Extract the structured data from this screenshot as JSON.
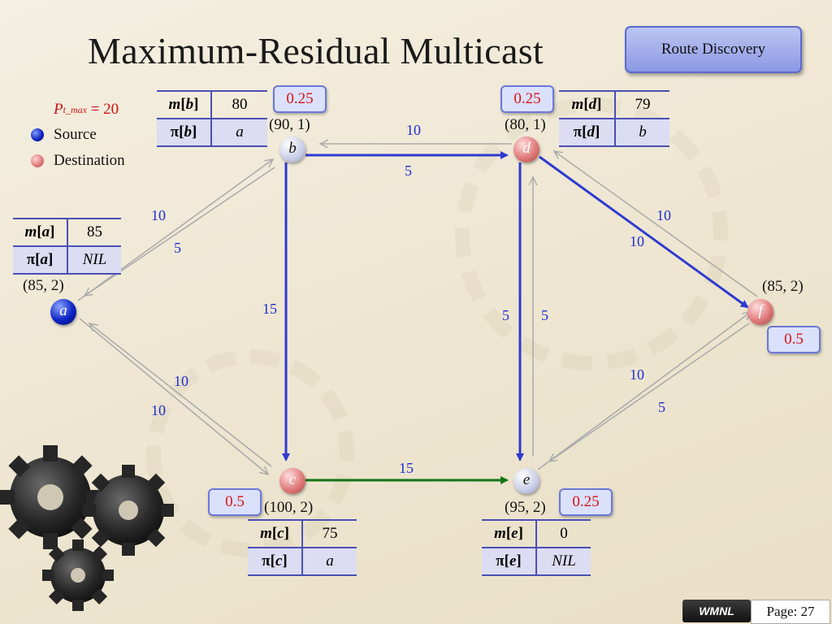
{
  "title": "Maximum-Residual Multicast",
  "route_button": "Route Discovery",
  "legend": {
    "p_t_max_symbol": "P",
    "p_t_max_sub": "t_max",
    "p_t_max_value": "= 20",
    "source_label": "Source",
    "destination_label": "Destination"
  },
  "nodes": {
    "a": {
      "label": "a",
      "coord": "(85, 2)"
    },
    "b": {
      "label": "b",
      "coord": "(90, 1)"
    },
    "c": {
      "label": "c",
      "coord": "(100, 2)"
    },
    "d": {
      "label": "d",
      "coord": "(80, 1)"
    },
    "e": {
      "label": "e",
      "coord": "(95, 2)"
    },
    "f": {
      "label": "f",
      "coord": "(85, 2)"
    }
  },
  "tables": {
    "a": {
      "m_key": "m[a]",
      "m_val": "85",
      "pi_key": "π[a]",
      "pi_val": "NIL"
    },
    "b": {
      "m_key": "m[b]",
      "m_val": "80",
      "pi_key": "π[b]",
      "pi_val": "a"
    },
    "c": {
      "m_key": "m[c]",
      "m_val": "75",
      "pi_key": "π[c]",
      "pi_val": "a"
    },
    "d": {
      "m_key": "m[d]",
      "m_val": "79",
      "pi_key": "π[d]",
      "pi_val": "b"
    },
    "e": {
      "m_key": "m[e]",
      "m_val": "0",
      "pi_key": "π[e]",
      "pi_val": "NIL"
    }
  },
  "badges": {
    "b": "0.25",
    "d": "0.25",
    "f": "0.5",
    "c": "0.5",
    "e": "0.25"
  },
  "edge_labels": {
    "bd_top": "10",
    "bd_bottom": "5",
    "ab_upper": "10",
    "ab_lower": "5",
    "bc": "15",
    "df_upper": "10",
    "df_lower": "10",
    "de_left": "5",
    "de_right": "5",
    "ac_upper": "10",
    "ac_lower": "10",
    "ef_upper": "10",
    "ef_lower": "5",
    "ce": "15"
  },
  "colors": {
    "tree_edge": "#2f3ad0",
    "green_edge": "#127412",
    "gray_edge": "#a9a9a9",
    "badge_text": "#d71414",
    "edge_label": "#1f2fd0"
  },
  "footer": {
    "wmnl": "WMNL",
    "page": "Page: 27"
  }
}
